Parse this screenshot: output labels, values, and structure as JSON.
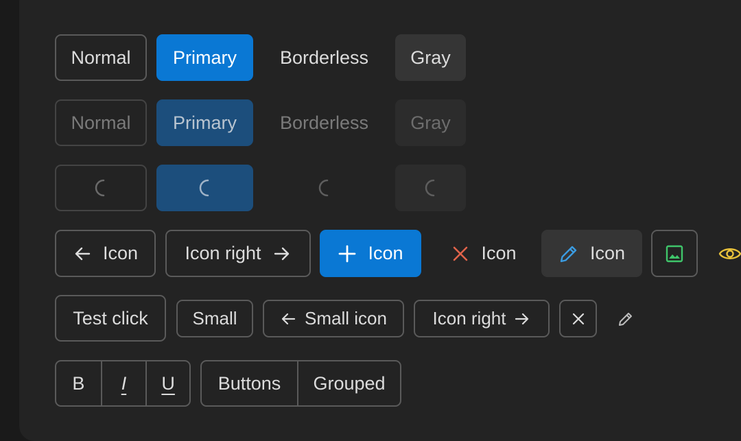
{
  "row1": {
    "normal": "Normal",
    "primary": "Primary",
    "borderless": "Borderless",
    "gray": "Gray"
  },
  "row2": {
    "normal": "Normal",
    "primary": "Primary",
    "borderless": "Borderless",
    "gray": "Gray"
  },
  "row4": {
    "icon_left": "Icon",
    "icon_right": "Icon right",
    "add": "Icon",
    "close": "Icon",
    "edit": "Icon"
  },
  "row5": {
    "test_click": "Test click",
    "small": "Small",
    "small_icon": "Small icon",
    "icon_right": "Icon right"
  },
  "format_group": {
    "bold": "B",
    "italic": "I",
    "underline": "U"
  },
  "button_group": {
    "first": "Buttons",
    "second": "Grouped"
  },
  "colors": {
    "background": "#1a1a1a",
    "panel": "#232323",
    "primary": "#0a78d4",
    "danger_icon": "#e0634a",
    "edit_icon": "#3b9be0",
    "image_icon": "#3fc56a",
    "eye_icon": "#e8c13a"
  }
}
